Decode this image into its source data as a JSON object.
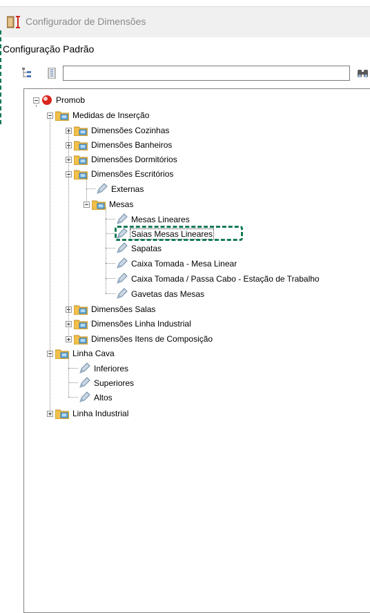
{
  "window": {
    "title": "Configurador de Dimensões",
    "subtitle": "Configuração Padrão"
  },
  "toolbar": {
    "search_value": ""
  },
  "colors": {
    "accent_dashed": "#137a52",
    "folder": "#f2c04a",
    "leaf_icon": "#9fb5c9"
  },
  "tree": {
    "items": [
      {
        "label": "Promob",
        "icon": "promob-icon",
        "toggle": "minus"
      },
      {
        "label": "Medidas de Inserção",
        "icon": "folder-icon",
        "toggle": "minus"
      },
      {
        "label": "Dimensões Cozinhas",
        "icon": "folder-icon",
        "toggle": "plus"
      },
      {
        "label": "Dimensões Banheiros",
        "icon": "folder-icon",
        "toggle": "plus"
      },
      {
        "label": "Dimensões Dormitórios",
        "icon": "folder-icon",
        "toggle": "plus"
      },
      {
        "label": "Dimensões Escritórios",
        "icon": "folder-icon",
        "toggle": "minus"
      },
      {
        "label": "Externas",
        "icon": "pencil-icon",
        "toggle": ""
      },
      {
        "label": "Mesas",
        "icon": "folder-icon",
        "toggle": "minus"
      },
      {
        "label": "Mesas Lineares",
        "icon": "pencil-icon",
        "toggle": ""
      },
      {
        "label": "Saias Mesas Lineares",
        "icon": "pencil-icon",
        "toggle": "",
        "selected": true
      },
      {
        "label": "Sapatas",
        "icon": "pencil-icon",
        "toggle": ""
      },
      {
        "label": "Caixa Tomada - Mesa Linear",
        "icon": "pencil-icon",
        "toggle": ""
      },
      {
        "label": "Caixa Tomada / Passa Cabo - Estação de Trabalho",
        "icon": "pencil-icon",
        "toggle": ""
      },
      {
        "label": "Gavetas das Mesas",
        "icon": "pencil-icon",
        "toggle": ""
      },
      {
        "label": "Dimensões Salas",
        "icon": "folder-icon",
        "toggle": "plus"
      },
      {
        "label": "Dimensões Linha Industrial",
        "icon": "folder-icon",
        "toggle": "plus"
      },
      {
        "label": "Dimensões Itens de Composição",
        "icon": "folder-icon",
        "toggle": "plus"
      },
      {
        "label": "Linha Cava",
        "icon": "folder-icon",
        "toggle": "minus"
      },
      {
        "label": "Inferiores",
        "icon": "pencil-icon",
        "toggle": ""
      },
      {
        "label": "Superiores",
        "icon": "pencil-icon",
        "toggle": ""
      },
      {
        "label": "Altos",
        "icon": "pencil-icon",
        "toggle": ""
      },
      {
        "label": "Linha Industrial",
        "icon": "folder-icon",
        "toggle": "plus"
      }
    ]
  }
}
